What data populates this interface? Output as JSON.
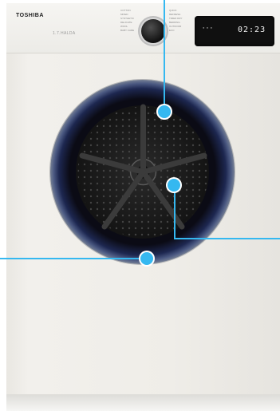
{
  "product": {
    "brand": "TOSHIBA",
    "model_label": "1.7.HALDA",
    "display_time": "02:23",
    "panel_text_left": [
      "COTTON",
      "MIXED",
      "SYNTHETIC",
      "DELICATE",
      "WOOL",
      "BABY CARE"
    ],
    "panel_text_right": [
      "QUICK",
      "REFRESH",
      "TIMED DRY",
      "BEDDING",
      "OUTDOOR",
      "ECO"
    ]
  },
  "callouts": [
    {
      "name": "top-callout"
    },
    {
      "name": "center-callout"
    },
    {
      "name": "bottom-callout"
    }
  ],
  "colors": {
    "accent": "#35b8f0",
    "door_ring": "#1d2750",
    "body": "#efede8"
  }
}
